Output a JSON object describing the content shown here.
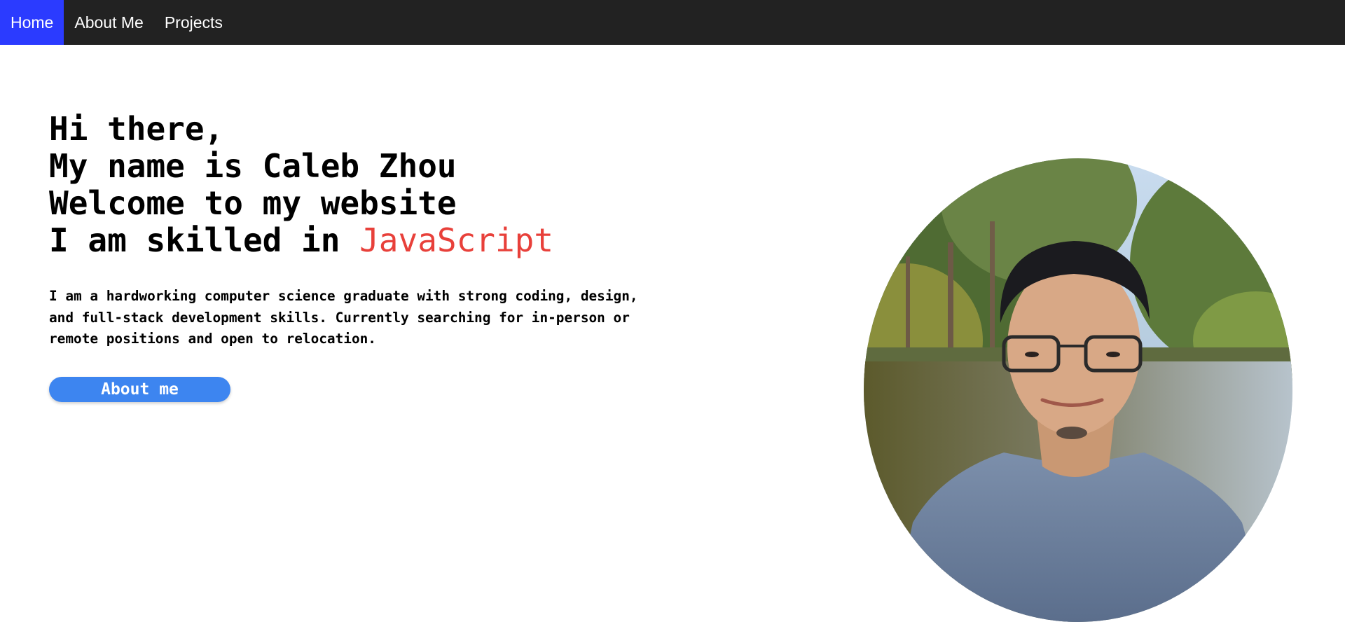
{
  "nav": {
    "items": [
      {
        "label": "Home",
        "active": true
      },
      {
        "label": "About Me",
        "active": false
      },
      {
        "label": "Projects",
        "active": false
      }
    ]
  },
  "hero": {
    "lines": [
      "Hi there,",
      "My name is Caleb Zhou",
      "Welcome to my website"
    ],
    "skill_prefix": "I am skilled in ",
    "skill": "JavaScript",
    "intro": "I am a hardworking computer science graduate with strong coding, design, and full-stack development skills. Currently searching for in-person or remote positions and open to relocation.",
    "button_label": "About me"
  },
  "colors": {
    "nav_background": "#222222",
    "nav_active": "#2b3bff",
    "skill_highlight": "#e8403a",
    "button": "#3d85f0"
  }
}
